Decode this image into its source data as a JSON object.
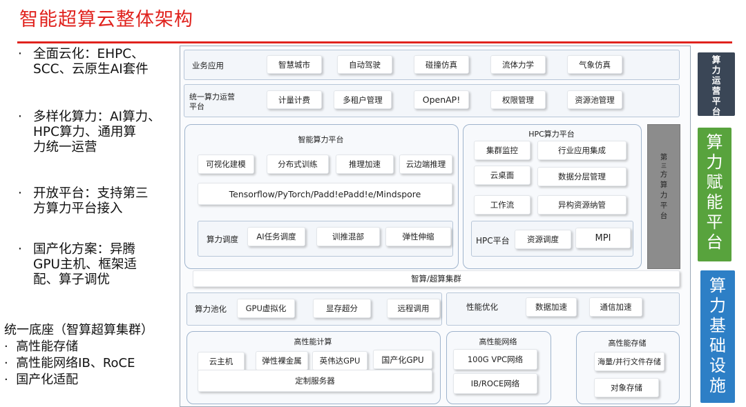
{
  "title": "智能超算云整体架构",
  "bullets": [
    {
      "dot": "·",
      "lines": [
        "全面云化：EHPC、",
        "SCC、云原生AI套件"
      ]
    },
    {
      "dot": "·",
      "lines": [
        "多样化算力：AI算力、",
        "HPC算力、通用算",
        "力统一运营"
      ]
    },
    {
      "dot": "·",
      "lines": [
        "开放平台：支持第三",
        "方算力平台接入"
      ]
    },
    {
      "dot": "·",
      "lines": [
        "国产化方案：异腾",
        "GPU主机、框架适",
        "配、算子调优"
      ]
    }
  ],
  "foundation": {
    "heading": "统一底座（智算超算集群）",
    "items": [
      "高性能存储",
      "高性能网络IB、RoCE",
      "国产化适配"
    ],
    "dot": "·"
  },
  "arch": {
    "business": {
      "label": "业务应用",
      "items": [
        "智慧城市",
        "自动驾驶",
        "碰撞仿真",
        "流体力学",
        "气象仿真"
      ]
    },
    "ops": {
      "label": "统一算力运营平台",
      "items": [
        "计量计费",
        "多租户管理",
        "OpenAP!",
        "权限管理",
        "资源池管理"
      ]
    },
    "ai": {
      "title": "智能算力平台",
      "items": [
        "可视化建模",
        "分布式训练",
        "推理加速",
        "云边端推理"
      ],
      "frameworks": "Tensorflow/PyTorch/Padd!ePadd!e/Mindspore",
      "scheduling": {
        "label": "算力调度",
        "items": [
          "AI任务调度",
          "训推混部",
          "弹性伸缩"
        ]
      }
    },
    "hpc": {
      "title": "HPC算力平台",
      "items": [
        "集群监控",
        "行业应用集成",
        "云桌面",
        "数据分层管理",
        "工作流",
        "异构资源纳管"
      ],
      "platform": {
        "label": "HPC平台",
        "items": [
          "资源调度",
          "MPI"
        ]
      }
    },
    "third_party": {
      "chars": [
        "第",
        "三",
        "方",
        "算",
        "力",
        "平",
        "台"
      ]
    },
    "cluster": {
      "label": "智算/超算集群"
    },
    "pooling": {
      "label": "算力池化",
      "items": [
        "GPU虚拟化",
        "显存超分",
        "远程调用"
      ]
    },
    "perf": {
      "label": "性能优化",
      "items": [
        "数据加速",
        "通信加速"
      ]
    },
    "compute": {
      "title": "高性能计算",
      "items": [
        "云主机",
        "弹性裸金属",
        "英伟达GPU",
        "国产化GPU"
      ],
      "custom": "定制服务器"
    },
    "network": {
      "title": "高性能网络",
      "items": [
        "100G VPC网络",
        "IB/ROCE网络"
      ]
    },
    "storage": {
      "title": "高性能存储",
      "items": [
        "海量/并行文件存储",
        "对象存储"
      ]
    }
  },
  "right_tags": [
    {
      "chars": [
        "算",
        "力",
        "运",
        "营",
        "平",
        "台"
      ],
      "color": "#3a4656"
    },
    {
      "chars": [
        "算",
        "力",
        "赋",
        "能",
        "平",
        "台"
      ],
      "color": "#58a33d"
    },
    {
      "chars": [
        "算",
        "力",
        "基",
        "础",
        "设",
        "施"
      ],
      "color": "#2d7fc6"
    }
  ],
  "colors": {
    "accent_red": "#e0221d",
    "third_party_gray": "#8c8c8c"
  }
}
